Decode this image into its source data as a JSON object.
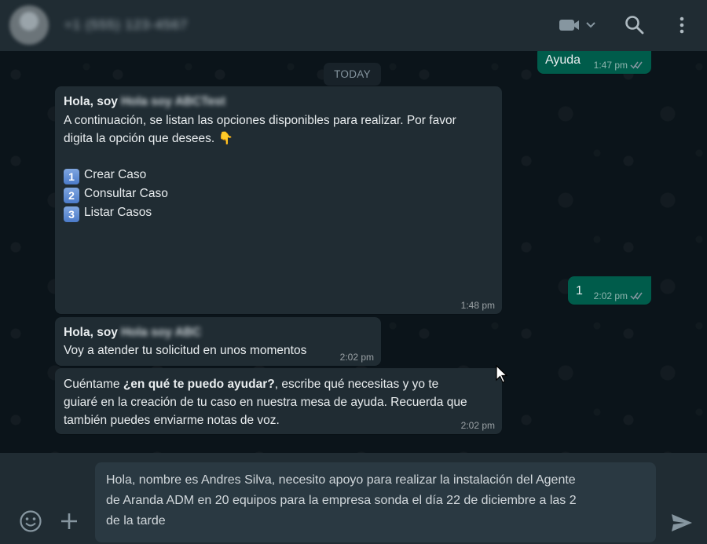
{
  "header": {
    "contact_name": "+1 (555) 123-4567",
    "icons": [
      "video-call-icon",
      "chevron-down-icon",
      "search-icon",
      "menu-icon"
    ]
  },
  "chat": {
    "date_label": "TODAY",
    "messages": [
      {
        "dir": "out",
        "text": "Ayuda",
        "time": "1:47 pm"
      },
      {
        "dir": "in",
        "greeting": "Hola, soy",
        "name": "Hola soy ABCTest",
        "line1": "A continuación, se listan las opciones disponibles para realizar. Por favor",
        "line2": "digita la opción que desees. 👇",
        "options": [
          {
            "key": "1",
            "label": "Crear Caso"
          },
          {
            "key": "2",
            "label": "Consultar Caso"
          },
          {
            "key": "3",
            "label": "Listar Casos"
          }
        ],
        "time": "1:48 pm"
      },
      {
        "dir": "out",
        "text": "1",
        "time": "2:02 pm"
      },
      {
        "dir": "in",
        "greeting": "Hola, soy",
        "name": "Hola soy ABC",
        "text": "Voy a atender tu solicitud en unos momentos",
        "time": "2:02 pm"
      },
      {
        "dir": "in",
        "prefix": "Cuéntame ",
        "bold": "¿en qué te puedo ayudar?",
        "rest1": ", escribe qué necesitas y yo te",
        "line2": "guiaré en la creación de tu caso en nuestra mesa de ayuda. Recuerda que",
        "line3": "también puedes enviarme notas de voz.",
        "time": "2:02 pm"
      }
    ]
  },
  "composer": {
    "line1": "Hola, nombre es Andres Silva, necesito apoyo para realizar la instalación del Agente",
    "line2": "de Aranda ADM en 20 equipos para la empresa sonda el día 22 de diciembre a las 2",
    "line3": "de la tarde"
  },
  "colors": {
    "header_bg": "#202c33",
    "chat_bg": "#0b141a",
    "incoming_bubble": "#202c33",
    "outgoing_bubble": "#005c4b",
    "read_ticks": "#8696a0"
  }
}
